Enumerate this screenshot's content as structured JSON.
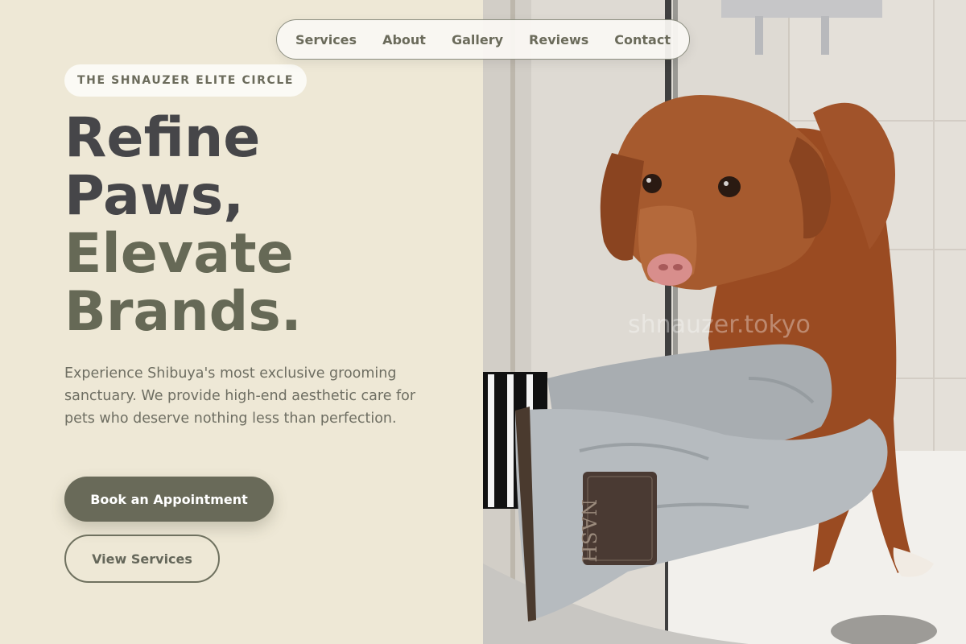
{
  "nav": {
    "items": [
      "Services",
      "About",
      "Gallery",
      "Reviews",
      "Contact"
    ]
  },
  "hero": {
    "eyebrow": "THE SHNAUZER ELITE CIRCLE",
    "title_line1": "Refine",
    "title_line2": "Paws,",
    "title_line3": "Elevate",
    "title_line4": "Brands.",
    "description": "Experience Shibuya's most exclusive grooming sanctuary. We provide high-end aesthetic care for pets who deserve nothing less than perfection.",
    "primary_button": "Book an Appointment",
    "secondary_button": "View Services"
  },
  "photo": {
    "watermark": "shnauzer.tokyo",
    "towel_label": "NASH"
  },
  "colors": {
    "background": "#eee8d6",
    "primary": "#696a59",
    "title_dark": "#464649",
    "title_accent": "#666956"
  }
}
